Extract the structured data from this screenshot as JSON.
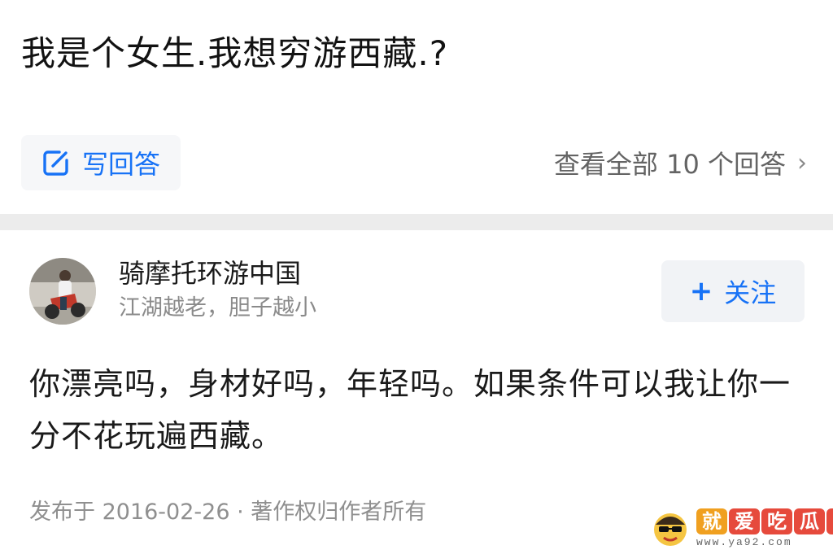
{
  "question": {
    "title": "我是个女生.我想穷游西藏.?"
  },
  "actions": {
    "write_answer_label": "写回答",
    "view_all_label": "查看全部 10 个回答",
    "chevron": "›"
  },
  "answer": {
    "author_name": "骑摩托环游中国",
    "author_bio": "江湖越老，胆子越小",
    "follow_label": "关注",
    "follow_plus": "+",
    "content": "你漂亮吗，身材好吗，年轻吗。如果条件可以我让你一分不花玩遍西藏。",
    "meta": "发布于 2016-02-26 · 著作权归作者所有"
  },
  "watermark": {
    "chars": [
      "就",
      "爱",
      "吃",
      "瓜",
      "网"
    ],
    "url": "www.ya92.com"
  },
  "colors": {
    "accent": "#1772f6",
    "button_bg": "#f6f7f9",
    "divider": "#ececec",
    "watermark": [
      "#f0a020",
      "#e64a3c",
      "#e64a3c",
      "#e64a3c",
      "#e64a3c"
    ]
  },
  "icons": {
    "write": "edit-icon",
    "avatar": "avatar-photo",
    "mascot": "mascot-icon"
  }
}
